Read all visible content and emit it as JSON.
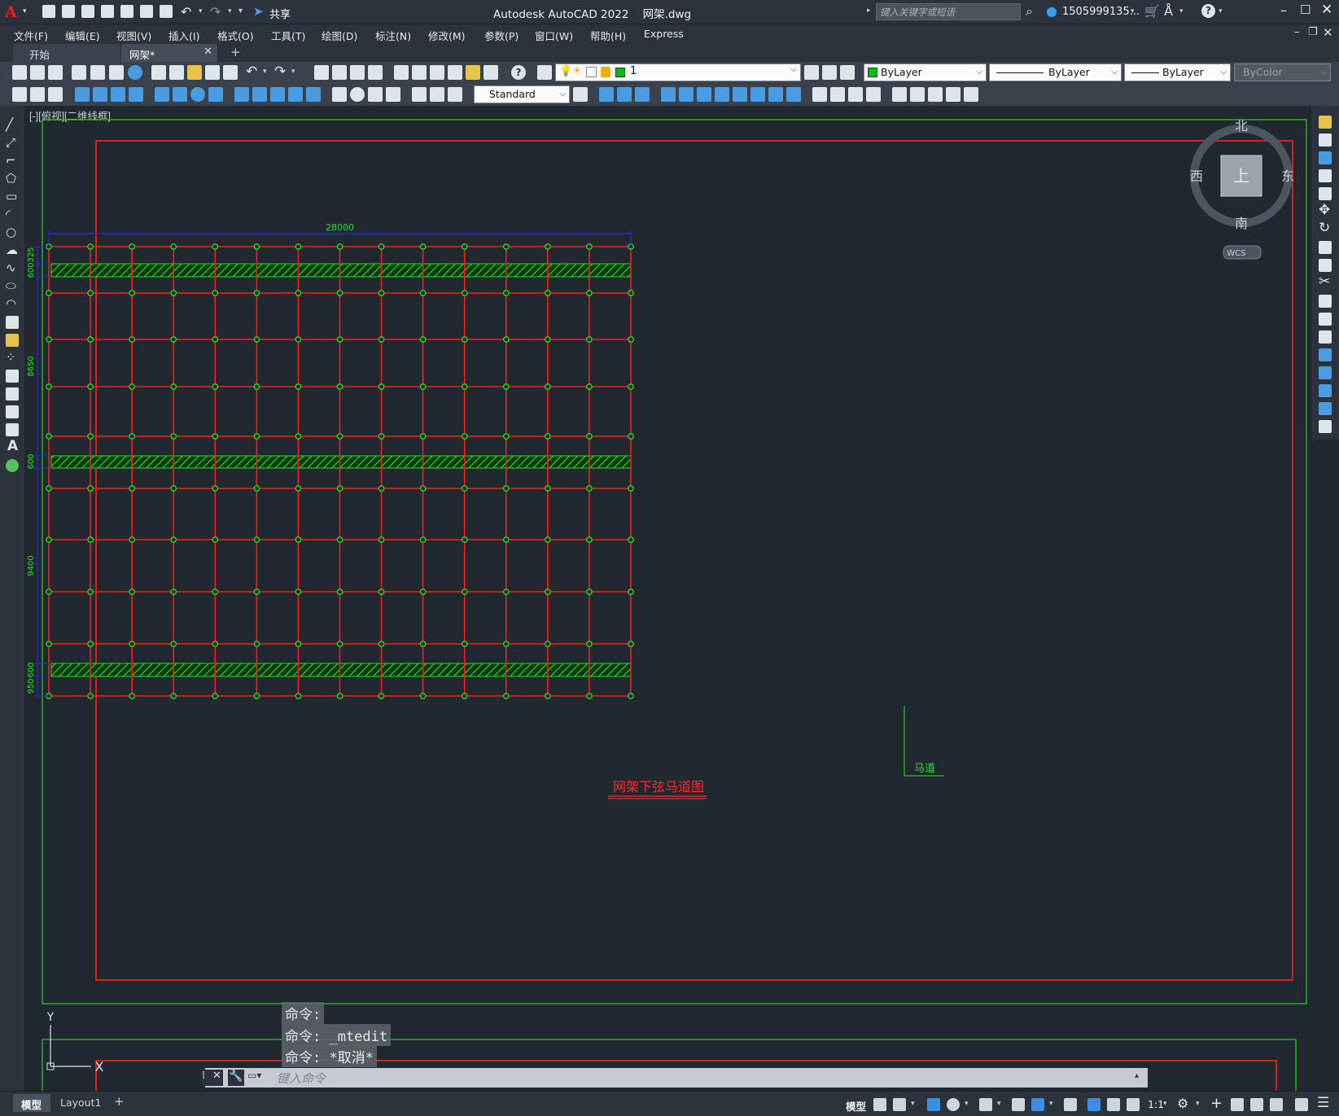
{
  "titlebar": {
    "app_title": "Autodesk AutoCAD 2022",
    "file_name": "网架.dwg",
    "share_label": "共享",
    "search_placeholder": "键入关键字或短语",
    "user_name": "1505999135..."
  },
  "menus": [
    "文件(F)",
    "编辑(E)",
    "视图(V)",
    "插入(I)",
    "格式(O)",
    "工具(T)",
    "绘图(D)",
    "标注(N)",
    "修改(M)",
    "参数(P)",
    "窗口(W)",
    "帮助(H)",
    "Express"
  ],
  "tabs": {
    "start": "开始",
    "drawing": "网架*"
  },
  "properties": {
    "layer_value": "1",
    "color_value": "ByLayer",
    "linetype_value": "ByLayer",
    "lineweight_value": "ByLayer",
    "plotstyle_value": "ByColor",
    "textstyle_value": "Standard",
    "layer_color": "#00c000"
  },
  "viewport": {
    "label": "[-][俯视][二维线框]"
  },
  "viewcube": {
    "north": "北",
    "south": "南",
    "east": "东",
    "west": "西",
    "face": "上",
    "wcs": "WCS"
  },
  "drawing": {
    "dim_top": "28000",
    "dim_left": [
      "325",
      "600",
      "8650",
      "600",
      "9400",
      "600",
      "950"
    ],
    "callout": "马道",
    "title": "网架下弦马道图",
    "colors": {
      "grid": "#ff1a1a",
      "node": "#24e024",
      "dim": "#1d2ce0",
      "frame": "#ff2020",
      "border": "#27c41f"
    }
  },
  "ucs": {
    "x": "X",
    "y": "Y"
  },
  "command": {
    "history": [
      "命令:",
      "命令: _mtedit",
      "命令: *取消*"
    ],
    "placeholder": "键入命令"
  },
  "layout_tabs": [
    "模型",
    "Layout1"
  ],
  "status": {
    "model_label": "模型",
    "scale_label": "1:1"
  }
}
